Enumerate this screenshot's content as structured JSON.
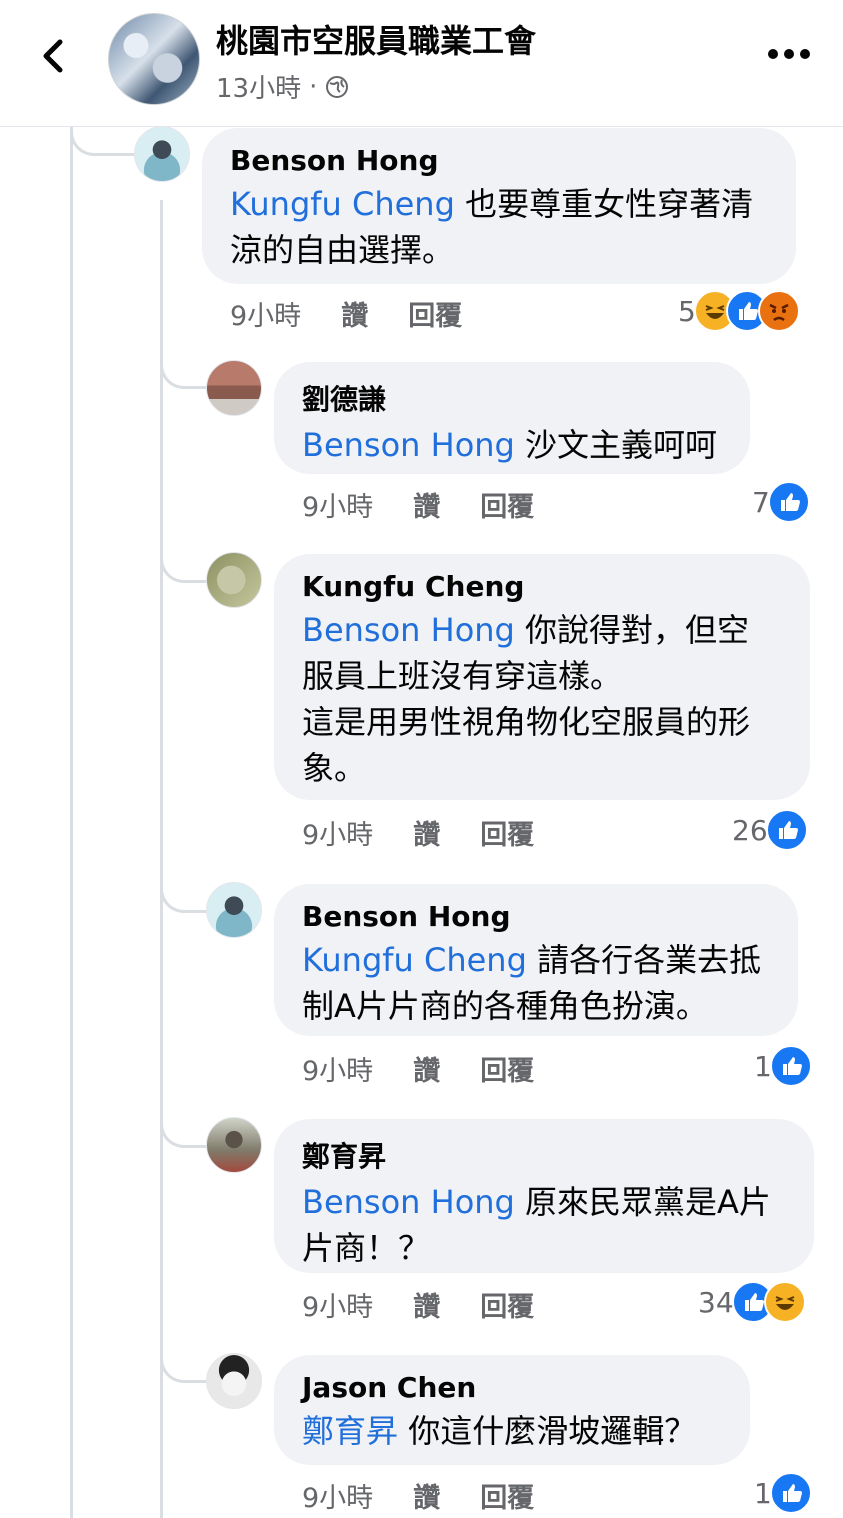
{
  "header": {
    "page_name": "桃園市空服員職業工會",
    "post_time": "13小時",
    "separator": "·"
  },
  "actions": {
    "like": "讚",
    "reply": "回覆"
  },
  "comments": [
    {
      "author": "Benson Hong",
      "mention": "Kungfu Cheng",
      "text_line1": " 也要尊重女性穿著清",
      "text_line2": "涼的自由選擇。",
      "time": "9小時",
      "count": "5",
      "reactions": [
        "haha",
        "like",
        "angry"
      ]
    },
    {
      "author": "劉德謙",
      "mention": "Benson Hong",
      "text_line1": " 沙文主義呵呵",
      "time": "9小時",
      "count": "7",
      "reactions": [
        "like"
      ]
    },
    {
      "author": "Kungfu Cheng",
      "mention": "Benson Hong",
      "text_line1": " 你說得對，但空",
      "text_line2": "服員上班沒有穿這樣。",
      "text_line3": "這是用男性視角物化空服員的形",
      "text_line4": "象。",
      "time": "9小時",
      "count": "26",
      "reactions": [
        "like"
      ]
    },
    {
      "author": "Benson Hong",
      "mention": "Kungfu Cheng",
      "text_line1": " 請各行各業去抵",
      "text_line2": "制A片片商的各種角色扮演。",
      "time": "9小時",
      "count": "1",
      "reactions": [
        "like"
      ]
    },
    {
      "author": "鄭育昇",
      "mention": "Benson Hong",
      "text_line1": " 原來民眾黨是A片",
      "text_line2": "片商！？",
      "time": "9小時",
      "count": "34",
      "reactions": [
        "like",
        "haha"
      ]
    },
    {
      "author": "Jason Chen",
      "mention": "鄭育昇",
      "text_line1": " 你這什麼滑坡邏輯？",
      "time": "9小時",
      "count": "1",
      "reactions": [
        "like"
      ]
    }
  ],
  "colors": {
    "mention": "#216fdb",
    "bubble": "#f0f2f5",
    "meta": "#65676b",
    "like": "#1877f2"
  },
  "icons": [
    "back-arrow-icon",
    "globe-icon",
    "more-icon",
    "like-reaction-icon",
    "haha-reaction-icon",
    "angry-reaction-icon"
  ]
}
